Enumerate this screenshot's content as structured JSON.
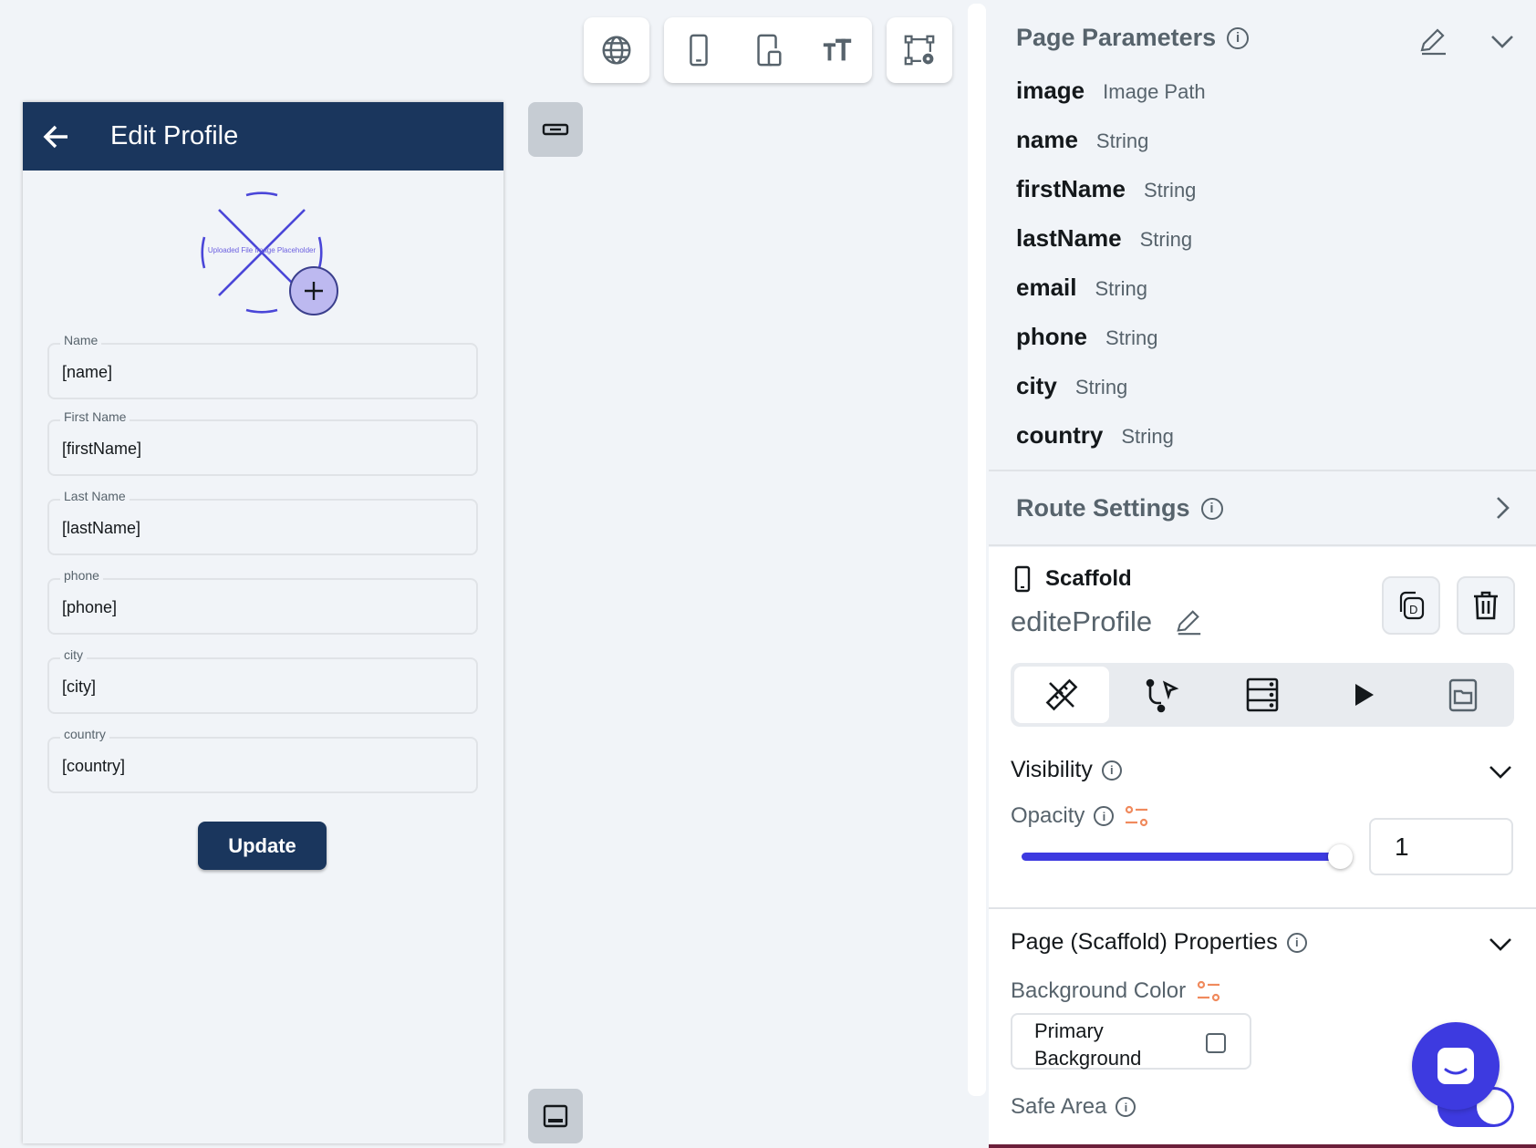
{
  "toolbar": {
    "icons": [
      "globe-icon",
      "phone-icon",
      "tablet-icon",
      "text-size-icon",
      "graph-settings-icon"
    ]
  },
  "phone_preview": {
    "appbar": {
      "title": "Edit Profile"
    },
    "avatar": {
      "placeholder_text": "Uploaded File Image Placeholder"
    },
    "fields": [
      {
        "label": "Name",
        "value": "[name]"
      },
      {
        "label": "First Name",
        "value": "[firstName]"
      },
      {
        "label": "Last Name",
        "value": "[lastName]"
      },
      {
        "label": "phone",
        "value": "[phone]"
      },
      {
        "label": "city",
        "value": "[city]"
      },
      {
        "label": "country",
        "value": "[country]"
      }
    ],
    "update_label": "Update"
  },
  "panel": {
    "page_parameters": {
      "title": "Page Parameters",
      "params": [
        {
          "name": "image",
          "type": "Image Path"
        },
        {
          "name": "name",
          "type": "String"
        },
        {
          "name": "firstName",
          "type": "String"
        },
        {
          "name": "lastName",
          "type": "String"
        },
        {
          "name": "email",
          "type": "String"
        },
        {
          "name": "phone",
          "type": "String"
        },
        {
          "name": "city",
          "type": "String"
        },
        {
          "name": "country",
          "type": "String"
        }
      ]
    },
    "route_settings": {
      "title": "Route Settings"
    },
    "scaffold": {
      "label": "Scaffold",
      "page_name": "editeProfile"
    },
    "visibility": {
      "title": "Visibility",
      "opacity_label": "Opacity",
      "opacity_value": "1",
      "opacity_fraction": 1.0
    },
    "page_properties": {
      "title": "Page (Scaffold) Properties",
      "background_color_label": "Background Color",
      "background_color_value": "Primary Background",
      "safe_area_label": "Safe Area",
      "safe_area_on": true
    },
    "colors": {
      "accent": "#3d3ae0",
      "appbar": "#1a365d",
      "variable_icon": "#f08a5d"
    }
  }
}
